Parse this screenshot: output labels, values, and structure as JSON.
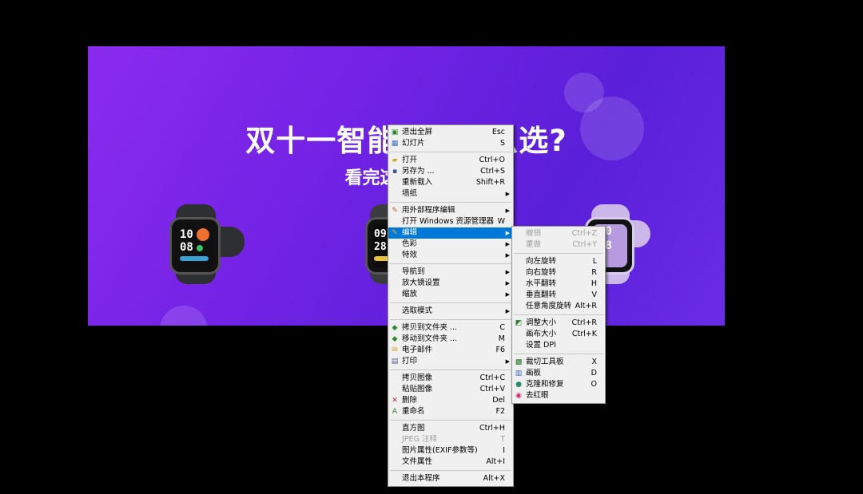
{
  "banner": {
    "title": "双十一智能手表怎么选?",
    "subtitle": "看完这篇就懂了"
  },
  "watches": [
    {
      "time_h": "10",
      "time_m": "08"
    },
    {
      "time_h": "09",
      "time_m": "28"
    },
    {
      "time_h": "10",
      "time_m": "08"
    }
  ],
  "context_menu": {
    "items": [
      {
        "label": "退出全屏",
        "shortcut": "Esc",
        "icon": "fullscreen-exit-icon"
      },
      {
        "label": "幻灯片",
        "shortcut": "S",
        "icon": "slideshow-icon"
      },
      {
        "sep": true
      },
      {
        "label": "打开",
        "shortcut": "Ctrl+O",
        "icon": "open-folder-icon"
      },
      {
        "label": "另存为 ...",
        "shortcut": "Ctrl+S",
        "icon": "floppy-disk-icon"
      },
      {
        "label": "重新载入",
        "shortcut": "Shift+R"
      },
      {
        "label": "墙纸",
        "submenu": true
      },
      {
        "sep": true
      },
      {
        "label": "用外部程序编辑",
        "submenu": true,
        "icon": "external-edit-icon"
      },
      {
        "label": "打开 Windows 资源管理器",
        "shortcut": "W"
      },
      {
        "label": "编辑",
        "submenu": true,
        "highlighted": true,
        "icon": "edit-brush-icon"
      },
      {
        "label": "色彩",
        "submenu": true
      },
      {
        "label": "特效",
        "submenu": true
      },
      {
        "sep": true
      },
      {
        "label": "导航到",
        "submenu": true
      },
      {
        "label": "放大镜设置",
        "submenu": true
      },
      {
        "label": "缩放",
        "submenu": true
      },
      {
        "sep": true
      },
      {
        "label": "选取模式",
        "submenu": true
      },
      {
        "sep": true
      },
      {
        "label": "拷贝到文件夹 ...",
        "shortcut": "C",
        "icon": "copy-to-folder-icon"
      },
      {
        "label": "移动到文件夹 ...",
        "shortcut": "M",
        "icon": "move-to-folder-icon"
      },
      {
        "label": "电子邮件",
        "shortcut": "F6",
        "icon": "email-icon"
      },
      {
        "label": "打印",
        "submenu": true,
        "icon": "printer-icon"
      },
      {
        "sep": true
      },
      {
        "label": "拷贝图像",
        "shortcut": "Ctrl+C"
      },
      {
        "label": "粘贴图像",
        "shortcut": "Ctrl+V"
      },
      {
        "label": "删除",
        "shortcut": "Del",
        "icon": "delete-x-icon"
      },
      {
        "label": "重命名",
        "shortcut": "F2",
        "icon": "rename-icon"
      },
      {
        "sep": true
      },
      {
        "label": "直方图",
        "shortcut": "Ctrl+H"
      },
      {
        "label": "JPEG 注释",
        "shortcut": "T",
        "disabled": true
      },
      {
        "label": "图片属性(EXIF参数等)",
        "shortcut": "I"
      },
      {
        "label": "文件属性",
        "shortcut": "Alt+I"
      },
      {
        "sep": true
      },
      {
        "label": "退出本程序",
        "shortcut": "Alt+X"
      }
    ]
  },
  "edit_submenu": {
    "items": [
      {
        "label": "撤销",
        "shortcut": "Ctrl+Z",
        "disabled": true
      },
      {
        "label": "重做",
        "shortcut": "Ctrl+Y",
        "disabled": true
      },
      {
        "sep": true
      },
      {
        "label": "向左旋转",
        "shortcut": "L"
      },
      {
        "label": "向右旋转",
        "shortcut": "R"
      },
      {
        "label": "水平翻转",
        "shortcut": "H"
      },
      {
        "label": "垂直翻转",
        "shortcut": "V"
      },
      {
        "label": "任意角度旋转",
        "shortcut": "Alt+R"
      },
      {
        "sep": true
      },
      {
        "label": "调整大小",
        "shortcut": "Ctrl+R",
        "icon": "resize-icon"
      },
      {
        "label": "画布大小",
        "shortcut": "Ctrl+K"
      },
      {
        "label": "设置 DPI",
        "shortcut": ""
      },
      {
        "sep": true
      },
      {
        "label": "裁切工具板",
        "shortcut": "X",
        "icon": "crop-toolbox-icon"
      },
      {
        "label": "画板",
        "shortcut": "D",
        "icon": "paint-board-icon"
      },
      {
        "label": "克隆和修复",
        "shortcut": "O",
        "icon": "clone-repair-icon"
      },
      {
        "label": "去红眼",
        "shortcut": "",
        "icon": "red-eye-icon"
      }
    ]
  },
  "colors": {
    "highlight": "#0078d7",
    "banner_start": "#8a2bef",
    "banner_end": "#5a1fd9"
  }
}
